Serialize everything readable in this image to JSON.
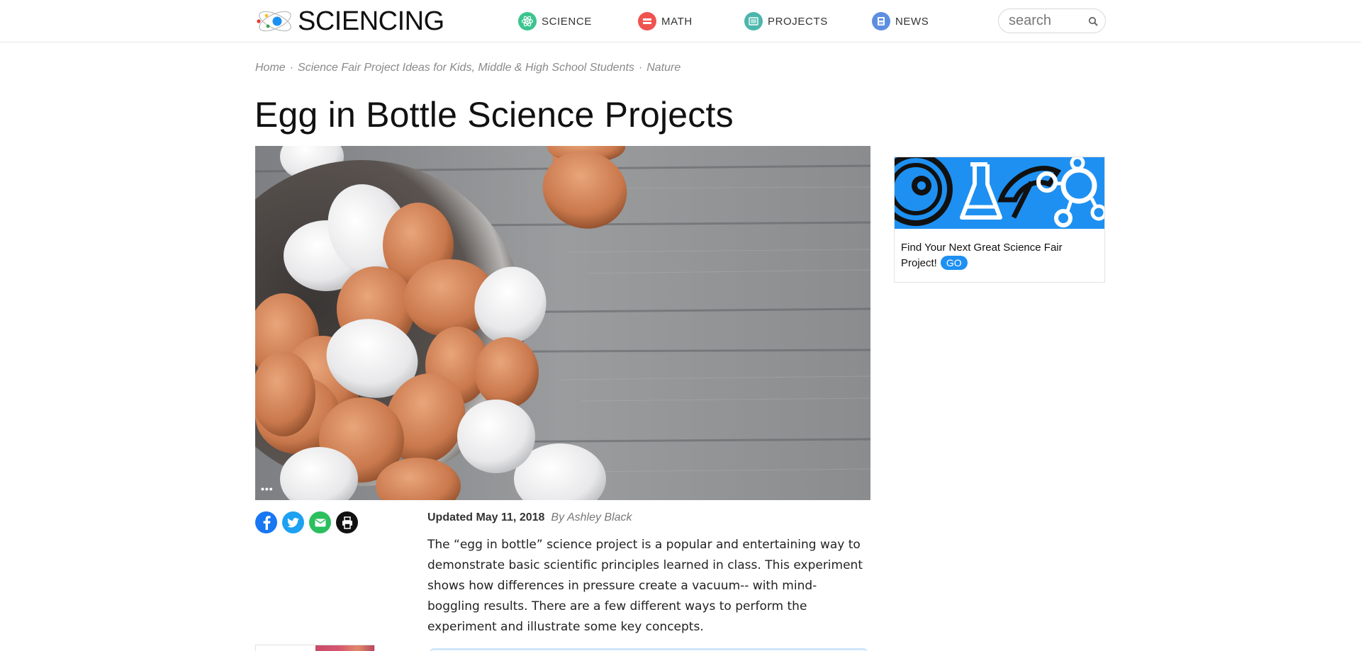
{
  "header": {
    "logo_text": "SCIENCING",
    "nav": [
      {
        "label": "SCIENCE",
        "icon": "atom-icon",
        "color": "#3cc48f"
      },
      {
        "label": "MATH",
        "icon": "equals-icon",
        "color": "#ef5350"
      },
      {
        "label": "PROJECTS",
        "icon": "board-icon",
        "color": "#4db6ac"
      },
      {
        "label": "NEWS",
        "icon": "newspaper-icon",
        "color": "#5c8fe0"
      }
    ],
    "search_placeholder": "search"
  },
  "breadcrumb": [
    "Home",
    "Science Fair Project Ideas for Kids, Middle & High School Students",
    "Nature"
  ],
  "article": {
    "title": "Egg in Bottle Science Projects",
    "updated": "Updated May 11, 2018",
    "author": "By Ashley Black",
    "intro": "The “egg in bottle” science project is a popular and entertaining way to demonstrate basic scientific principles learned in class. This experiment shows how differences in pressure create a vacuum-- with mind-boggling results. There are a few different ways to perform the experiment and illustrate some key concepts.",
    "image_more": "•••"
  },
  "share": [
    {
      "name": "facebook-icon",
      "color": "#1877f2"
    },
    {
      "name": "twitter-icon",
      "color": "#1da1f2"
    },
    {
      "name": "email-icon",
      "color": "#2bbf5e"
    },
    {
      "name": "print-icon",
      "color": "#111111"
    }
  ],
  "sidebar": {
    "promo_text": "Find Your Next Great Science Fair Project!",
    "go_label": "GO",
    "banner_color": "#1e90f2"
  }
}
